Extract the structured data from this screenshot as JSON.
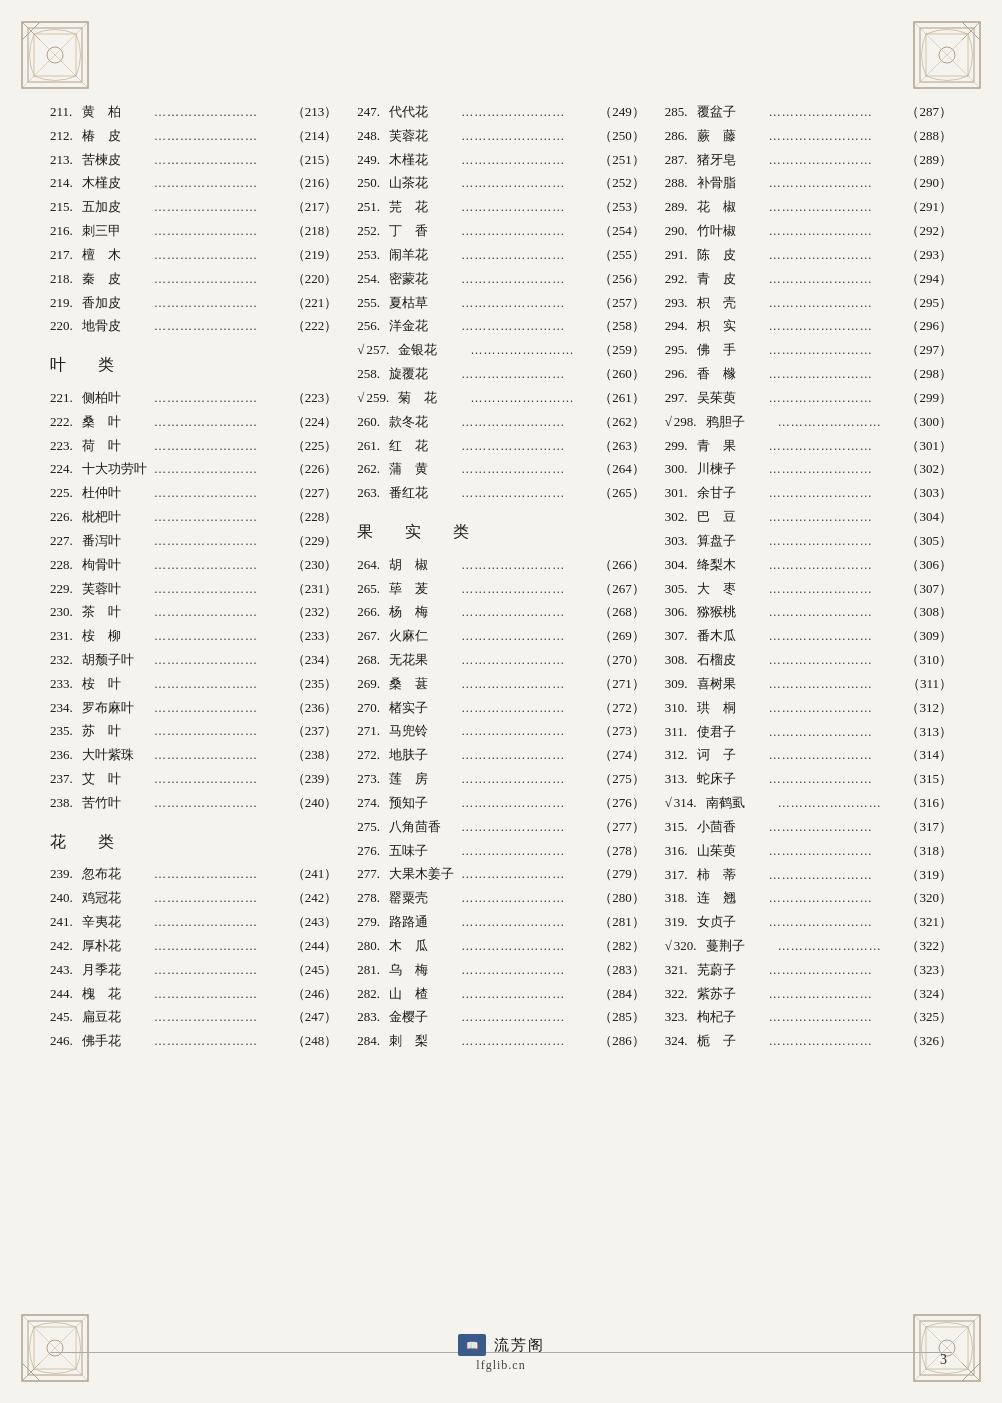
{
  "page": {
    "number": "3",
    "footer": {
      "name": "流芳阁",
      "url": "lfglib.cn"
    }
  },
  "columns": [
    {
      "id": "col1",
      "entries": [
        {
          "num": "211.",
          "name": "黄　柏",
          "page": "213"
        },
        {
          "num": "212.",
          "name": "椿　皮",
          "page": "214"
        },
        {
          "num": "213.",
          "name": "苦楝皮",
          "page": "215"
        },
        {
          "num": "214.",
          "name": "木槿皮",
          "page": "216"
        },
        {
          "num": "215.",
          "name": "五加皮",
          "page": "217"
        },
        {
          "num": "216.",
          "name": "刺三甲",
          "page": "218"
        },
        {
          "num": "217.",
          "name": "檀　木",
          "page": "219"
        },
        {
          "num": "218.",
          "name": "秦　皮",
          "page": "220"
        },
        {
          "num": "219.",
          "name": "香加皮",
          "page": "221"
        },
        {
          "num": "220.",
          "name": "地骨皮",
          "page": "222"
        }
      ],
      "sections": [
        {
          "title": "叶　类",
          "entries": [
            {
              "num": "221.",
              "name": "侧柏叶",
              "page": "223"
            },
            {
              "num": "222.",
              "name": "桑　叶",
              "page": "224"
            },
            {
              "num": "223.",
              "name": "荷　叶",
              "page": "225"
            },
            {
              "num": "224.",
              "name": "十大功劳叶",
              "page": "226"
            },
            {
              "num": "225.",
              "name": "杜仲叶",
              "page": "227"
            },
            {
              "num": "226.",
              "name": "枇杷叶",
              "page": "228"
            },
            {
              "num": "227.",
              "name": "番泻叶",
              "page": "229"
            },
            {
              "num": "228.",
              "name": "枸骨叶",
              "page": "230"
            },
            {
              "num": "229.",
              "name": "芙蓉叶",
              "page": "231"
            },
            {
              "num": "230.",
              "name": "茶　叶",
              "page": "232"
            },
            {
              "num": "231.",
              "name": "桉　柳",
              "page": "233"
            },
            {
              "num": "232.",
              "name": "胡颓子叶",
              "page": "234"
            },
            {
              "num": "233.",
              "name": "桉　叶",
              "page": "235"
            },
            {
              "num": "234.",
              "name": "罗布麻叶",
              "page": "236"
            },
            {
              "num": "235.",
              "name": "苏　叶",
              "page": "237"
            },
            {
              "num": "236.",
              "name": "大叶紫珠",
              "page": "238"
            },
            {
              "num": "237.",
              "name": "艾　叶",
              "page": "239"
            },
            {
              "num": "238.",
              "name": "苦竹叶",
              "page": "240"
            }
          ]
        },
        {
          "title": "花　类",
          "entries": [
            {
              "num": "239.",
              "name": "忽布花",
              "page": "241"
            },
            {
              "num": "240.",
              "name": "鸡冠花",
              "page": "242"
            },
            {
              "num": "241.",
              "name": "辛夷花",
              "page": "243"
            },
            {
              "num": "242.",
              "name": "厚朴花",
              "page": "244"
            },
            {
              "num": "243.",
              "name": "月季花",
              "page": "245"
            },
            {
              "num": "244.",
              "name": "槐　花",
              "page": "246"
            },
            {
              "num": "245.",
              "name": "扁豆花",
              "page": "247"
            },
            {
              "num": "246.",
              "name": "佛手花",
              "page": "248",
              "note": "※"
            }
          ]
        }
      ]
    },
    {
      "id": "col2",
      "entries": [
        {
          "num": "247.",
          "name": "代代花",
          "page": "249"
        },
        {
          "num": "248.",
          "name": "芙蓉花",
          "page": "250"
        },
        {
          "num": "249.",
          "name": "木槿花",
          "page": "251"
        },
        {
          "num": "250.",
          "name": "山茶花",
          "page": "252"
        },
        {
          "num": "251.",
          "name": "芫　花",
          "page": "253"
        },
        {
          "num": "252.",
          "name": "丁　香",
          "page": "254"
        },
        {
          "num": "253.",
          "name": "闹羊花",
          "page": "255"
        },
        {
          "num": "254.",
          "name": "密蒙花",
          "page": "256"
        },
        {
          "num": "255.",
          "name": "夏枯草",
          "page": "257"
        },
        {
          "num": "256.",
          "name": "洋金花",
          "page": "258"
        },
        {
          "num": "257.",
          "name": "金银花",
          "page": "259",
          "check": true
        },
        {
          "num": "258.",
          "name": "旋覆花",
          "page": "260"
        },
        {
          "num": "259.",
          "name": "菊　花",
          "page": "261",
          "check": true
        },
        {
          "num": "260.",
          "name": "款冬花",
          "page": "262"
        },
        {
          "num": "261.",
          "name": "红　花",
          "page": "263"
        },
        {
          "num": "262.",
          "name": "蒲　黄",
          "page": "264"
        },
        {
          "num": "263.",
          "name": "番红花",
          "page": "265"
        }
      ],
      "sections": [
        {
          "title": "果　实　类",
          "entries": [
            {
              "num": "264.",
              "name": "胡　椒",
              "page": "266"
            },
            {
              "num": "265.",
              "name": "荜　茇",
              "page": "267"
            },
            {
              "num": "266.",
              "name": "杨　梅",
              "page": "268"
            },
            {
              "num": "267.",
              "name": "火麻仁",
              "page": "269"
            },
            {
              "num": "268.",
              "name": "无花果",
              "page": "270"
            },
            {
              "num": "269.",
              "name": "桑　葚",
              "page": "271"
            },
            {
              "num": "270.",
              "name": "楮实子",
              "page": "272"
            },
            {
              "num": "271.",
              "name": "马兜铃",
              "page": "273"
            },
            {
              "num": "272.",
              "name": "地肤子",
              "page": "274"
            },
            {
              "num": "273.",
              "name": "莲　房",
              "page": "275"
            },
            {
              "num": "274.",
              "name": "预知子",
              "page": "276"
            },
            {
              "num": "275.",
              "name": "八角茴香",
              "page": "277"
            },
            {
              "num": "276.",
              "name": "五味子",
              "page": "278"
            },
            {
              "num": "277.",
              "name": "大果木姜子",
              "page": "279"
            },
            {
              "num": "278.",
              "name": "罂粟壳",
              "page": "280"
            },
            {
              "num": "279.",
              "name": "路路通",
              "page": "281"
            },
            {
              "num": "280.",
              "name": "木　瓜",
              "page": "282"
            },
            {
              "num": "281.",
              "name": "乌　梅",
              "page": "283"
            },
            {
              "num": "282.",
              "name": "山　楂",
              "page": "284"
            },
            {
              "num": "283.",
              "name": "金樱子",
              "page": "285"
            },
            {
              "num": "284.",
              "name": "刺　梨",
              "page": "286"
            }
          ]
        }
      ]
    },
    {
      "id": "col3",
      "entries": [
        {
          "num": "285.",
          "name": "覆盆子",
          "page": "287"
        },
        {
          "num": "286.",
          "name": "蕨　藤",
          "page": "288"
        },
        {
          "num": "287.",
          "name": "猪牙皂",
          "page": "289"
        },
        {
          "num": "288.",
          "name": "补骨脂",
          "page": "290"
        },
        {
          "num": "289.",
          "name": "花　椒",
          "page": "291"
        },
        {
          "num": "290.",
          "name": "竹叶椒",
          "page": "292"
        },
        {
          "num": "291.",
          "name": "陈　皮",
          "page": "293"
        },
        {
          "num": "292.",
          "name": "青　皮",
          "page": "294"
        },
        {
          "num": "293.",
          "name": "枳　壳",
          "page": "295"
        },
        {
          "num": "294.",
          "name": "枳　实",
          "page": "296"
        },
        {
          "num": "295.",
          "name": "佛　手",
          "page": "297"
        },
        {
          "num": "296.",
          "name": "香　橼",
          "page": "298"
        },
        {
          "num": "297.",
          "name": "吴茱萸",
          "page": "299"
        },
        {
          "num": "298.",
          "name": "鸦胆子",
          "page": "300",
          "note": "√"
        },
        {
          "num": "299.",
          "name": "青　果",
          "page": "301"
        },
        {
          "num": "300.",
          "name": "川楝子",
          "page": "302"
        },
        {
          "num": "301.",
          "name": "余甘子",
          "page": "303"
        },
        {
          "num": "302.",
          "name": "巴　豆",
          "page": "304"
        },
        {
          "num": "303.",
          "name": "算盘子",
          "page": "305"
        },
        {
          "num": "304.",
          "name": "绛梨木",
          "page": "306"
        },
        {
          "num": "305.",
          "name": "大　枣",
          "page": "307"
        },
        {
          "num": "306.",
          "name": "猕猴桃",
          "page": "308"
        },
        {
          "num": "307.",
          "name": "番木瓜",
          "page": "309"
        },
        {
          "num": "308.",
          "name": "石榴皮",
          "page": "310"
        },
        {
          "num": "309.",
          "name": "喜树果",
          "page": "311"
        },
        {
          "num": "310.",
          "name": "珙　桐",
          "page": "312"
        },
        {
          "num": "311.",
          "name": "使君子",
          "page": "313"
        },
        {
          "num": "312.",
          "name": "诃　子",
          "page": "314"
        },
        {
          "num": "313.",
          "name": "蛇床子",
          "page": "315"
        },
        {
          "num": "314.",
          "name": "南鹤虱",
          "page": "316",
          "note": "√"
        },
        {
          "num": "315.",
          "name": "小茴香",
          "page": "317"
        },
        {
          "num": "316.",
          "name": "山茱萸",
          "page": "318"
        },
        {
          "num": "317.",
          "name": "柿　蒂",
          "page": "319"
        },
        {
          "num": "318.",
          "name": "连　翘",
          "page": "320"
        },
        {
          "num": "319.",
          "name": "女贞子",
          "page": "321"
        },
        {
          "num": "320.",
          "name": "蔓荆子",
          "page": "322",
          "note": "√"
        },
        {
          "num": "321.",
          "name": "芜蔚子",
          "page": "323"
        },
        {
          "num": "322.",
          "name": "紫苏子",
          "page": "324"
        },
        {
          "num": "323.",
          "name": "枸杞子",
          "page": "325"
        },
        {
          "num": "324.",
          "name": "栀　子",
          "page": "326"
        }
      ]
    }
  ]
}
